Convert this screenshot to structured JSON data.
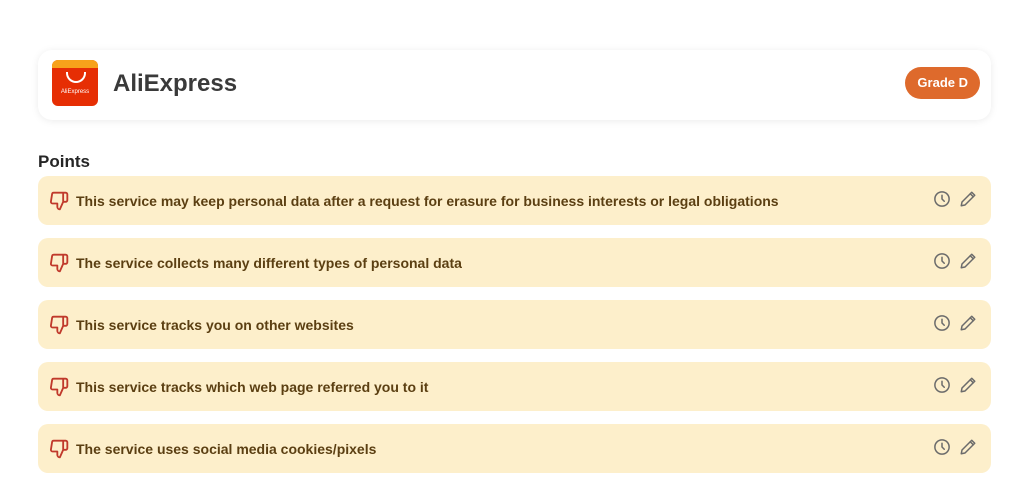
{
  "service": {
    "name": "AliExpress",
    "logo_text": "AliExpress",
    "grade": "Grade D",
    "grade_color": "#de6a2c"
  },
  "points": {
    "heading": "Points",
    "item_bg_color": "#fdefcb",
    "bad_icon_color": "#c0392b",
    "items": [
      {
        "text": "This service may keep personal data after a request for erasure for business interests or legal obligations",
        "icon": "thumbs-down-icon"
      },
      {
        "text": "The service collects many different types of personal data",
        "icon": "thumbs-down-icon"
      },
      {
        "text": "This service tracks you on other websites",
        "icon": "thumbs-down-icon"
      },
      {
        "text": "This service tracks which web page referred you to it",
        "icon": "thumbs-down-icon"
      },
      {
        "text": "The service uses social media cookies/pixels",
        "icon": "thumbs-down-icon"
      }
    ]
  }
}
